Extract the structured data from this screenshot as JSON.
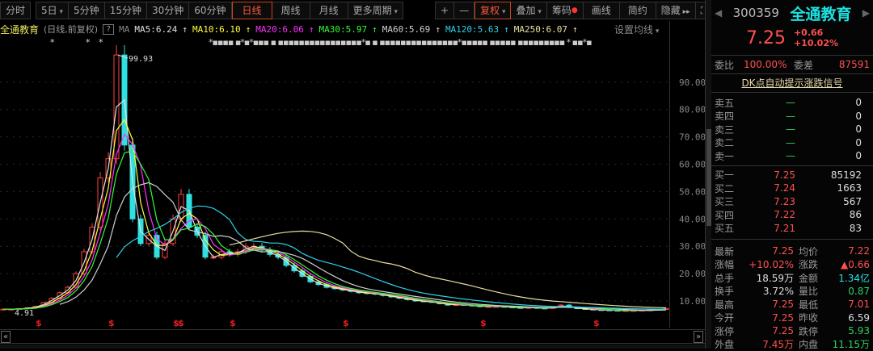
{
  "toolbar": {
    "tabs": [
      "分时",
      "5日",
      "5分钟",
      "15分钟",
      "30分钟",
      "60分钟",
      "日线",
      "周线",
      "月线",
      "更多周期"
    ],
    "active": "日线",
    "right": [
      "+",
      "—",
      "复权",
      "叠加",
      "筹码",
      "画线",
      "简约",
      "隐藏"
    ],
    "fullscreen_icon": "expand-icon"
  },
  "ma_header": {
    "name": "全通教育",
    "sub": "(日线,前复权)",
    "help": "?",
    "ma": "MA",
    "items": [
      {
        "label": "MA5:6.24",
        "color": "#e0e0e0"
      },
      {
        "label": "MA10:6.10",
        "color": "#ffff3c"
      },
      {
        "label": "MA20:6.06",
        "color": "#ff30ff"
      },
      {
        "label": "MA30:5.97",
        "color": "#30ff30"
      },
      {
        "label": "MA60:5.69",
        "color": "#d0d0d0"
      },
      {
        "label": "MA120:5.63",
        "color": "#2ed0e8"
      },
      {
        "label": "MA250:6.07",
        "color": "#e8e0a0"
      }
    ],
    "set_ma": "设置均线"
  },
  "chart_data": {
    "type": "candlestick",
    "title": "全通教育 日线 前复权",
    "ylim": [
      4,
      102
    ],
    "yticks": [
      "90.00",
      "80.00",
      "70.00",
      "60.00",
      "50.00",
      "40.00",
      "30.00",
      "20.00",
      "10.00"
    ],
    "ytick_values": [
      90,
      80,
      70,
      60,
      50,
      40,
      30,
      20,
      10
    ],
    "closes": [
      7,
      7,
      7.2,
      7.5,
      8,
      9.4,
      11,
      13,
      15,
      20,
      28,
      37,
      55,
      62,
      99.93,
      67,
      40,
      31,
      34,
      26,
      31,
      40,
      49,
      37,
      34,
      26,
      26,
      28,
      27,
      28,
      30,
      30,
      28.6,
      27,
      26,
      23,
      21,
      19,
      17,
      16,
      15,
      14.5,
      14,
      13.5,
      13,
      12.8,
      12.5,
      12,
      11.5,
      11,
      10.5,
      10,
      9.8,
      9.5,
      9,
      8.5,
      8.7,
      8.5,
      8.2,
      8,
      8,
      8,
      7.8,
      7.6,
      7.5,
      7.6,
      7.4,
      7.3,
      7.8,
      8.5,
      7.6,
      7.2,
      7,
      6.8,
      6.7,
      6.6,
      6.5,
      6.5,
      6.5,
      6.6,
      6.7,
      6.9,
      7.25
    ],
    "high_label": "99.93",
    "low_label": "4.91",
    "signal_marker": "$",
    "signal_indices": [
      4,
      13,
      21,
      22,
      28,
      42,
      59,
      73
    ]
  },
  "right": {
    "code": "300359",
    "name": "全通教育",
    "price": "7.25",
    "change": "+0.66",
    "pct": "+10.02%",
    "weibi_l": "委比",
    "weibi": "100.00%",
    "weicha_l": "委差",
    "weicha": "87591",
    "dk": "DK点自动提示涨跌信号",
    "sell": [
      {
        "l": "卖五",
        "p": "—",
        "v": "0"
      },
      {
        "l": "卖四",
        "p": "—",
        "v": "0"
      },
      {
        "l": "卖三",
        "p": "—",
        "v": "0"
      },
      {
        "l": "卖二",
        "p": "—",
        "v": "0"
      },
      {
        "l": "卖一",
        "p": "—",
        "v": "0"
      }
    ],
    "buy": [
      {
        "l": "买一",
        "p": "7.25",
        "v": "85192"
      },
      {
        "l": "买二",
        "p": "7.24",
        "v": "1663"
      },
      {
        "l": "买三",
        "p": "7.23",
        "v": "567"
      },
      {
        "l": "买四",
        "p": "7.22",
        "v": "86"
      },
      {
        "l": "买五",
        "p": "7.21",
        "v": "83"
      }
    ],
    "stats": [
      {
        "l1": "最新",
        "v1": "7.25",
        "c1": "red",
        "l2": "均价",
        "v2": "7.22",
        "c2": "red"
      },
      {
        "l1": "涨幅",
        "v1": "+10.02%",
        "c1": "red",
        "l2": "涨跌",
        "v2": "▲0.66",
        "c2": "red"
      },
      {
        "l1": "总手",
        "v1": "18.59万",
        "c1": "wht",
        "l2": "金额",
        "v2": "1.34亿",
        "c2": "cyan"
      },
      {
        "l1": "换手",
        "v1": "3.72%",
        "c1": "wht",
        "l2": "量比",
        "v2": "0.87",
        "c2": "grn"
      },
      {
        "l1": "最高",
        "v1": "7.25",
        "c1": "red",
        "l2": "最低",
        "v2": "7.01",
        "c2": "red"
      },
      {
        "l1": "今开",
        "v1": "7.25",
        "c1": "red",
        "l2": "昨收",
        "v2": "6.59",
        "c2": "wht"
      },
      {
        "l1": "涨停",
        "v1": "7.25",
        "c1": "red",
        "l2": "跌停",
        "v2": "5.93",
        "c2": "grn"
      },
      {
        "l1": "外盘",
        "v1": "7.45万",
        "c1": "red",
        "l2": "内盘",
        "v2": "11.15万",
        "c2": "grn"
      }
    ]
  }
}
